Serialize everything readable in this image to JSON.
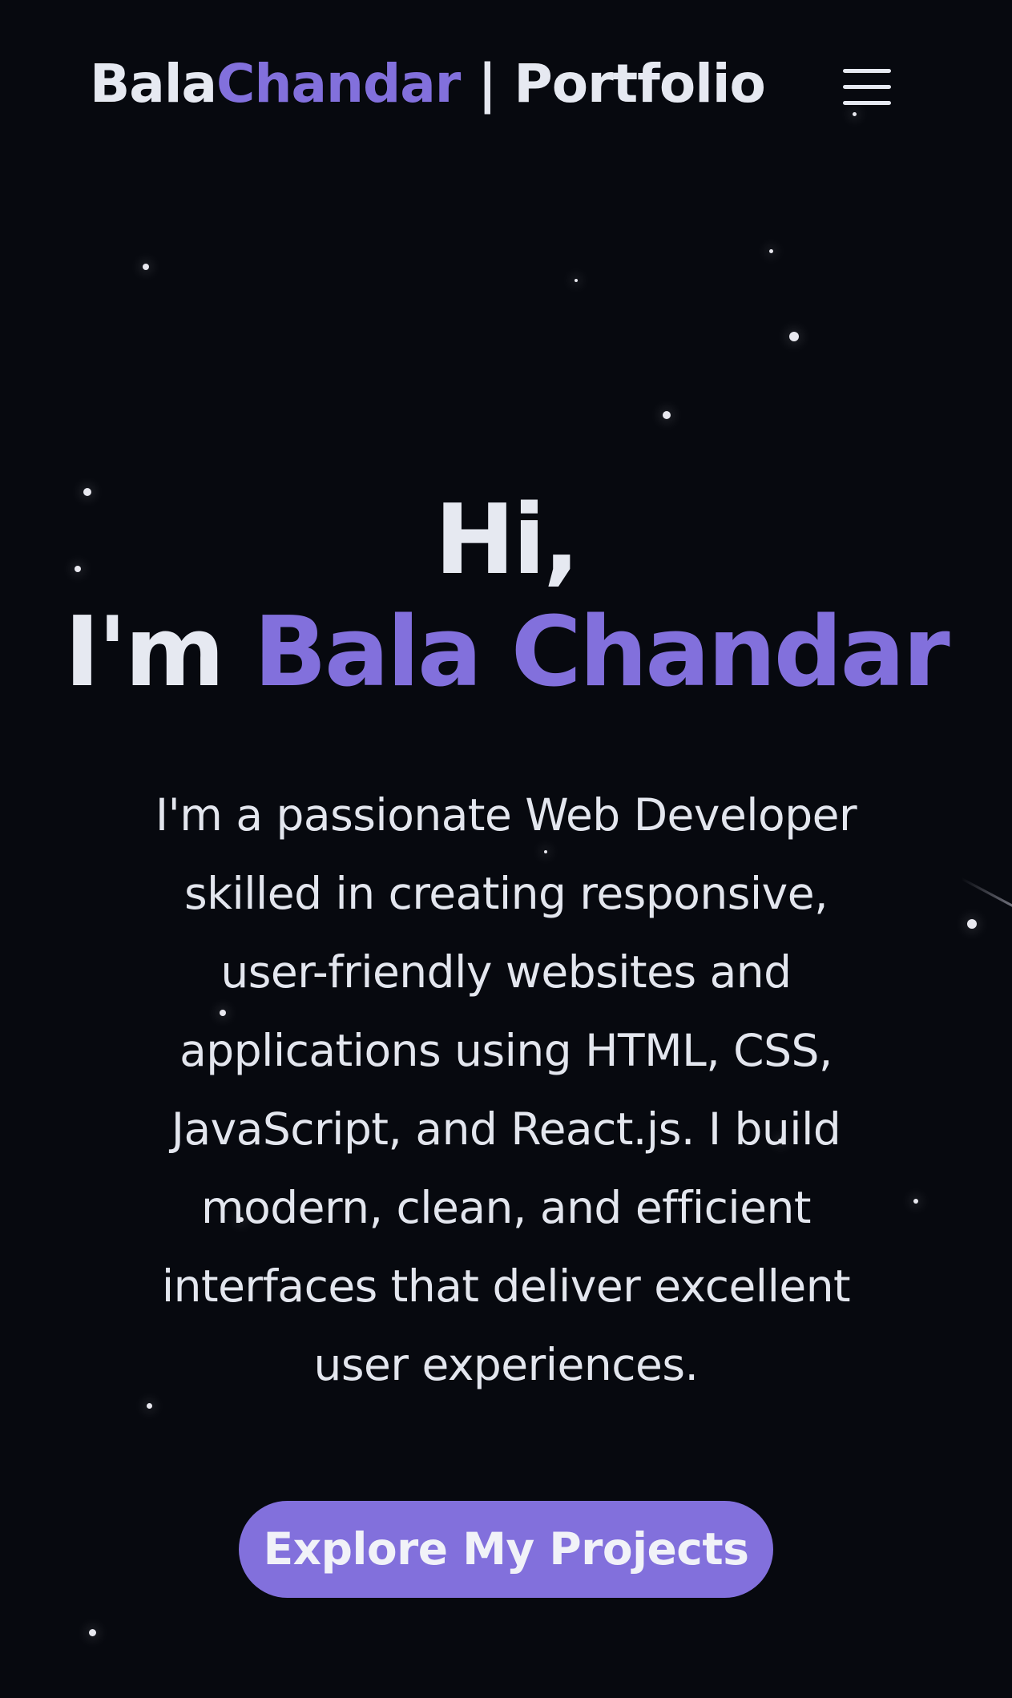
{
  "header": {
    "brand_first": "Bala",
    "brand_accent": "Chandar",
    "brand_rest": " | Portfolio",
    "menu_icon": "hamburger-menu-icon"
  },
  "hero": {
    "greeting": "Hi,",
    "intro_prefix": "I'm ",
    "name": "Bala Chandar",
    "description": "I'm a passionate Web Developer skilled in creating responsive, user-friendly websites and applications using HTML, CSS, JavaScript, and React.js. I build modern, clean, and efficient interfaces that deliver excellent user experiences.",
    "cta_label": "Explore My Projects"
  },
  "colors": {
    "background": "#07090f",
    "accent": "#8270dc",
    "text": "#e6e9f1"
  }
}
